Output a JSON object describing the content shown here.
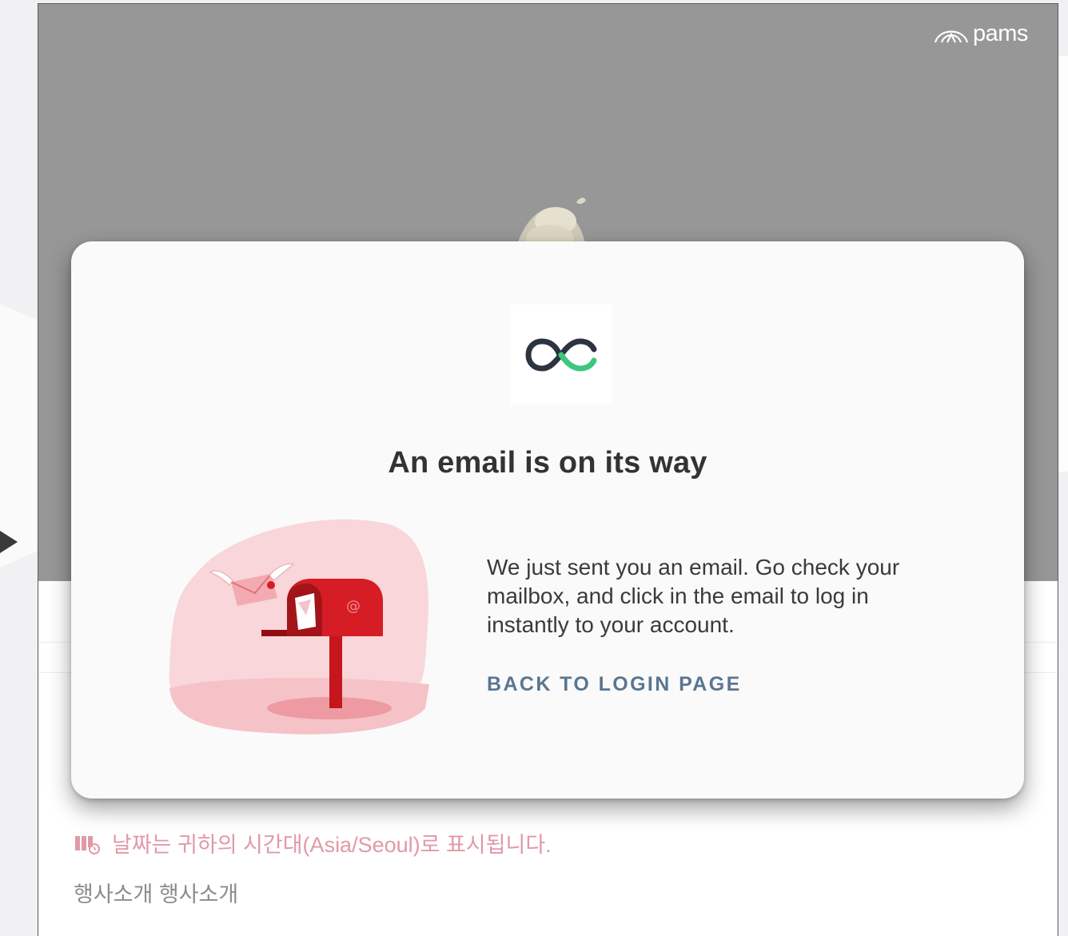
{
  "brand": {
    "name": "pams"
  },
  "modal": {
    "title": "An email is on its way",
    "message": "We just sent you an email. Go check your mailbox, and click in the email to log in instantly to your account.",
    "back_label": "BACK TO LOGIN PAGE",
    "accent_color": "#5a7690",
    "logo_colors": {
      "dark": "#2b3440",
      "green": "#3cc77f"
    }
  },
  "page": {
    "date_note": "날짜는 귀하의 시간대(Asia/Seoul)로 표시됩니다.",
    "event_intro": "행사소개 행사소개",
    "date_note_color": "#e09aa6"
  }
}
